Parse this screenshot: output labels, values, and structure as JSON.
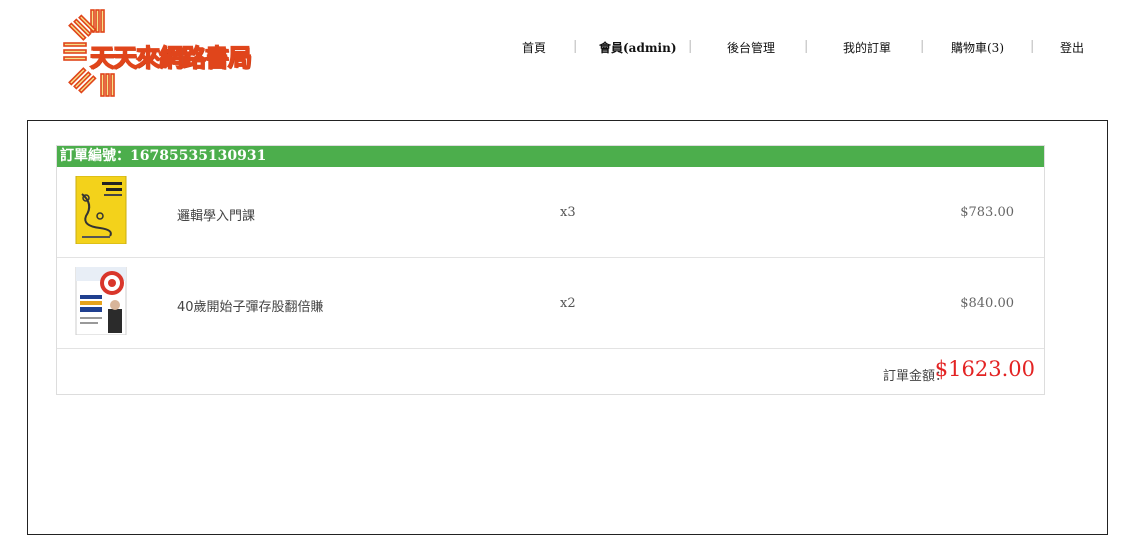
{
  "brand": {
    "name": "天天來網路書局"
  },
  "nav": {
    "home": "首頁",
    "member": "會員(admin)",
    "admin": "後台管理",
    "my_orders": "我的訂單",
    "cart": "購物車(3)",
    "logout": "登出",
    "separator": "|"
  },
  "order": {
    "header_label": "訂單編號：",
    "number": "16785535130931",
    "items": [
      {
        "title": "邏輯學入門課",
        "qty": "x3",
        "price": "$783.00"
      },
      {
        "title": "40歲開始子彈存股翻倍賺",
        "qty": "x2",
        "price": "$840.00"
      }
    ],
    "total_label": "訂單金額：",
    "total_amount": "$1623.00"
  },
  "colors": {
    "header_green": "#4cae4c",
    "total_red": "#e32323",
    "logo_orange": "#e0451b",
    "logo_yellow": "#f2c200"
  }
}
